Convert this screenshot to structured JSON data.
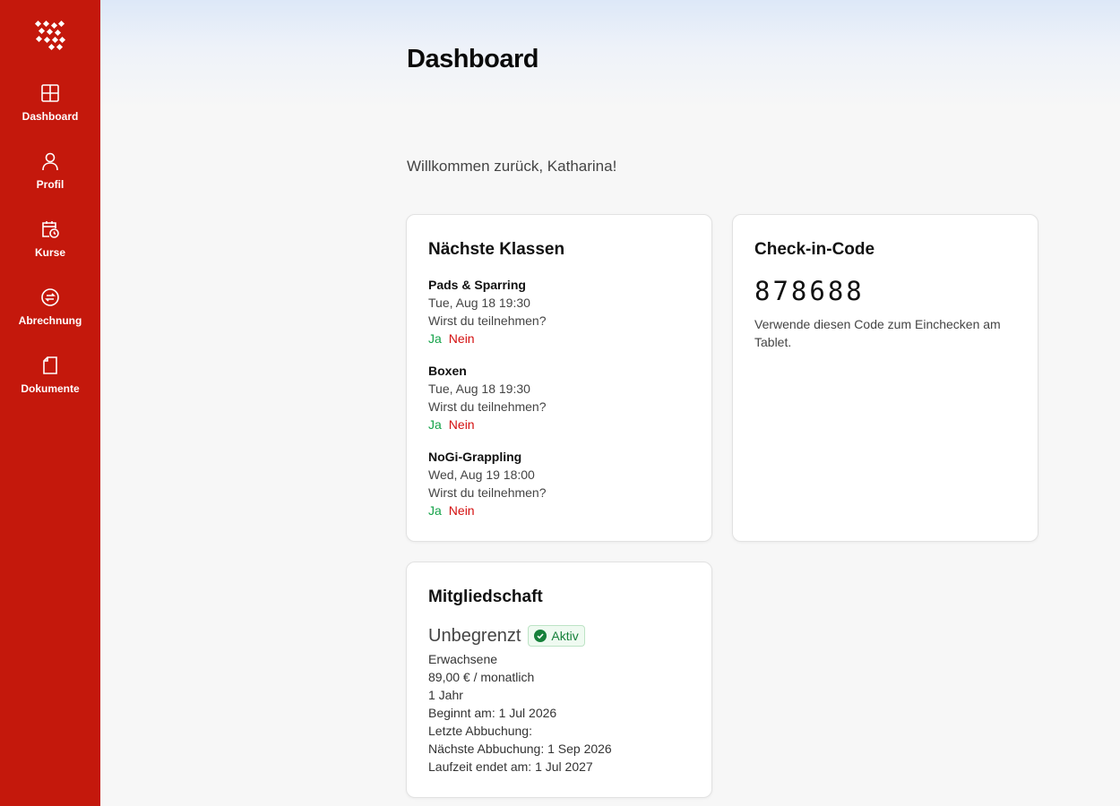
{
  "sidebar": {
    "items": [
      {
        "label": "Dashboard",
        "icon": "dashboard-grid-icon"
      },
      {
        "label": "Profil",
        "icon": "user-icon"
      },
      {
        "label": "Kurse",
        "icon": "calendar-clock-icon"
      },
      {
        "label": "Abrechnung",
        "icon": "billing-icon"
      },
      {
        "label": "Dokumente",
        "icon": "document-icon"
      }
    ]
  },
  "page": {
    "title": "Dashboard",
    "welcome": "Willkommen zurück, Katharina!"
  },
  "classes": {
    "title": "Nächste Klassen",
    "items": [
      {
        "name": "Pads & Sparring",
        "time": "Tue, Aug 18 19:30",
        "question": "Wirst du teilnehmen?",
        "yes": "Ja",
        "no": "Nein"
      },
      {
        "name": "Boxen",
        "time": "Tue, Aug 18 19:30",
        "question": "Wirst du teilnehmen?",
        "yes": "Ja",
        "no": "Nein"
      },
      {
        "name": "NoGi-Grappling",
        "time": "Wed, Aug 19 18:00",
        "question": "Wirst du teilnehmen?",
        "yes": "Ja",
        "no": "Nein"
      }
    ]
  },
  "checkin": {
    "title": "Check-in-Code",
    "code": "878688",
    "description": "Verwende diesen Code zum Einchecken am Tablet."
  },
  "membership": {
    "title": "Mitgliedschaft",
    "plan": "Unbegrenzt",
    "status": "Aktiv",
    "details": [
      "Erwachsene",
      "89,00 € / monatlich",
      "1 Jahr",
      "Beginnt am: 1 Jul 2026",
      "Letzte Abbuchung:",
      "Nächste Abbuchung: 1 Sep 2026",
      "Laufzeit endet am: 1 Jul 2027"
    ]
  },
  "colors": {
    "brand": "#c4180c",
    "yes": "#16a34a",
    "no": "#d40f0f",
    "badge": "#16803a"
  }
}
